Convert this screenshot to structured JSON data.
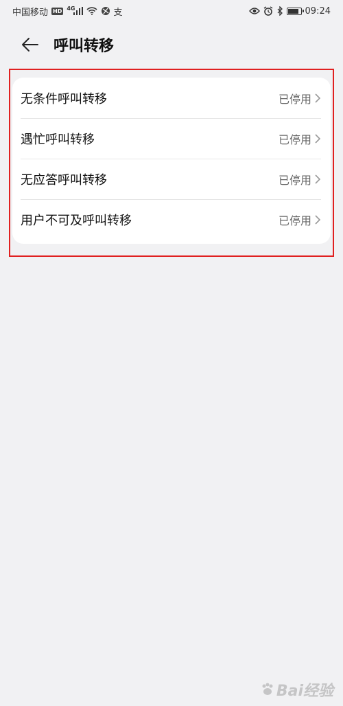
{
  "status_bar": {
    "carrier": "中国移动",
    "hd": "HD",
    "network": "4G",
    "ime": "支",
    "time": "09:24"
  },
  "header": {
    "title": "呼叫转移"
  },
  "options": [
    {
      "label": "无条件呼叫转移",
      "status": "已停用"
    },
    {
      "label": "遇忙呼叫转移",
      "status": "已停用"
    },
    {
      "label": "无应答呼叫转移",
      "status": "已停用"
    },
    {
      "label": "用户不可及呼叫转移",
      "status": "已停用"
    }
  ],
  "highlight_color": "#e02020",
  "watermark": {
    "text": "Bai经验"
  }
}
